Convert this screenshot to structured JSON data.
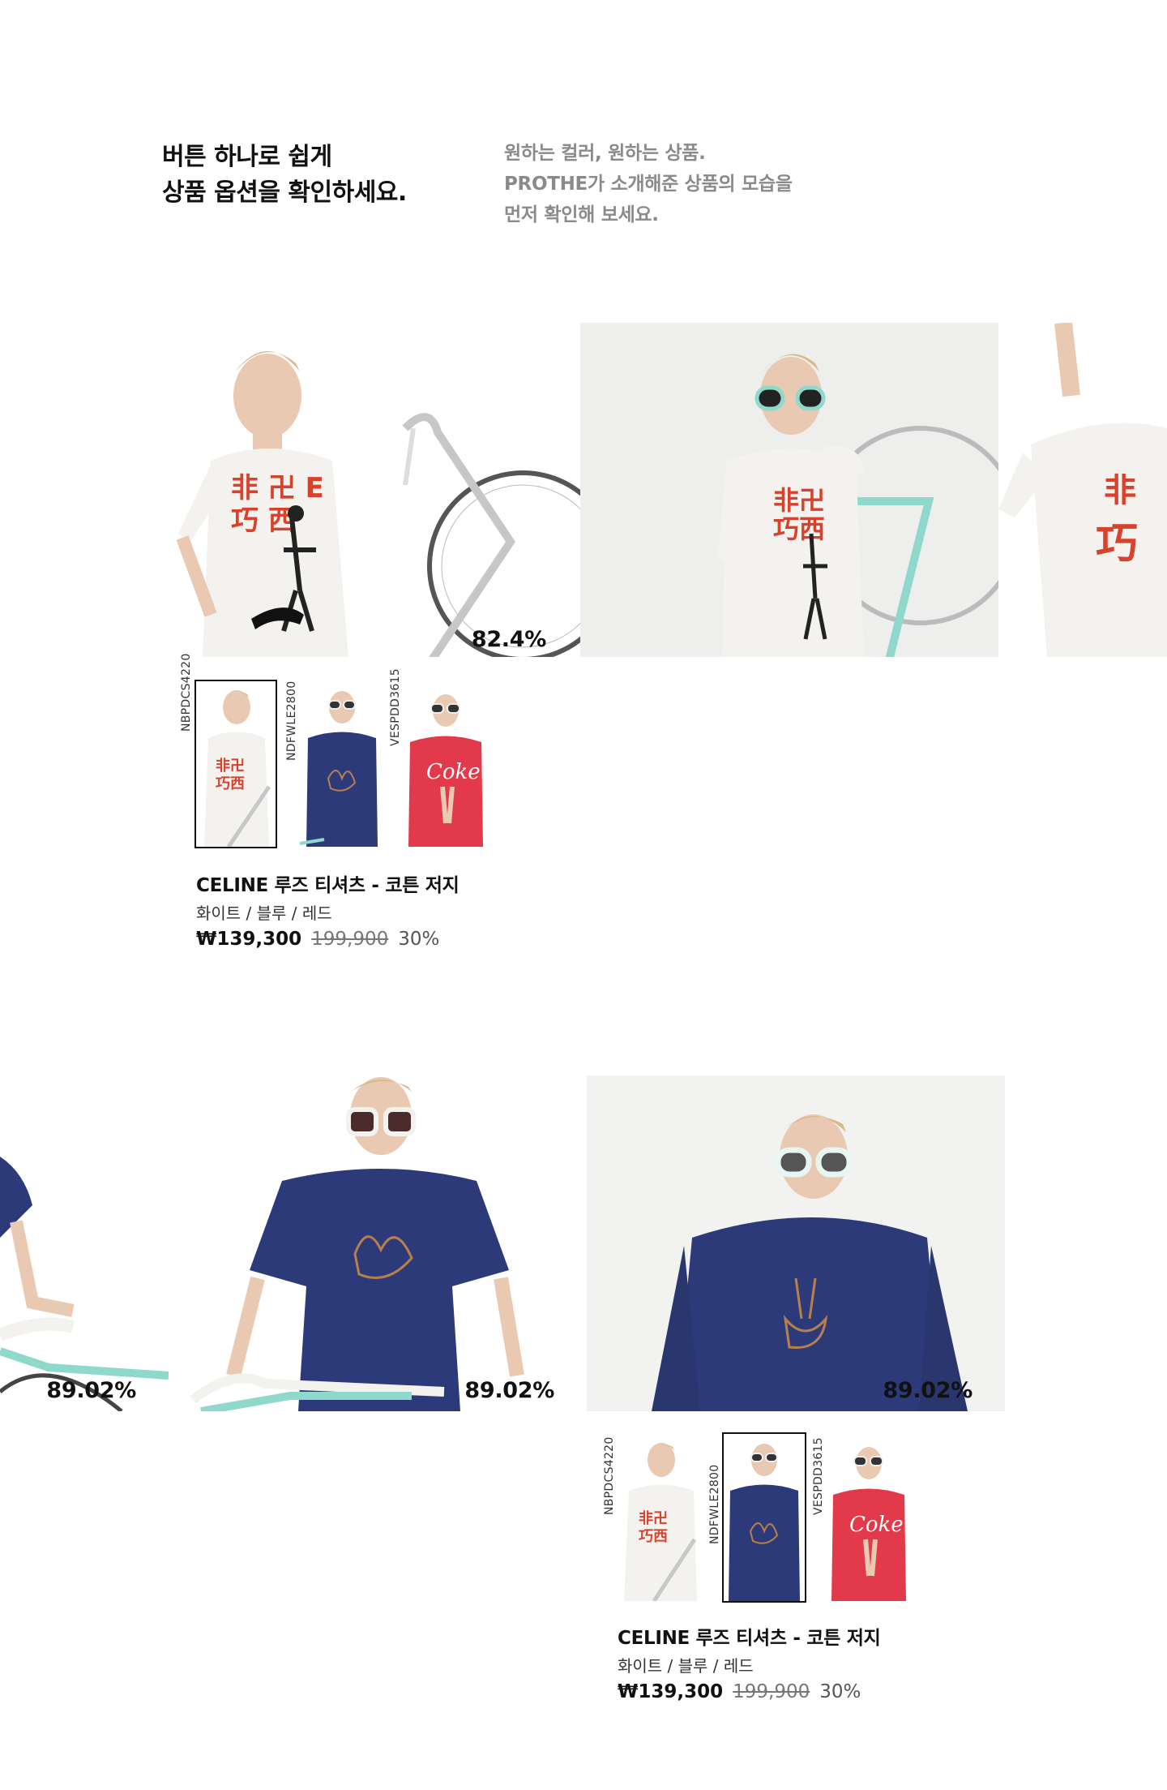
{
  "intro": {
    "headline_lines": [
      "버튼 하나로 쉽게",
      "상품 옵션을 확인하세요."
    ],
    "sub_lines": [
      "원하는 컬러, 원하는 상품.",
      "PROTHE가 소개해준 상품의 모습을",
      "먼저 확인해 보세요."
    ]
  },
  "section1": {
    "tiles": [
      {
        "percent": "82.4%",
        "shirt": "white"
      },
      {
        "percent": "",
        "shirt": "white"
      },
      {
        "percent": "",
        "shirt": "white"
      }
    ],
    "thumbnails": [
      {
        "sku": "NBPDCS4220",
        "shirt": "white",
        "selected": true
      },
      {
        "sku": "NDFWLE2800",
        "shirt": "navy",
        "selected": false
      },
      {
        "sku": "VESPDD3615",
        "shirt": "red",
        "selected": false
      }
    ],
    "product": {
      "name": "CELINE 루즈 티셔츠 - 코튼 저지",
      "colors": "화이트 / 블루 / 레드",
      "price": "₩139,300",
      "original_price": "199,900",
      "discount": "30%"
    }
  },
  "section2": {
    "tiles": [
      {
        "percent": "89.02%",
        "shirt": "navy"
      },
      {
        "percent": "89.02%",
        "shirt": "navy"
      },
      {
        "percent": "89.02%",
        "shirt": "navy"
      }
    ],
    "thumbnails": [
      {
        "sku": "NBPDCS4220",
        "shirt": "white",
        "selected": false
      },
      {
        "sku": "NDFWLE2800",
        "shirt": "navy",
        "selected": true
      },
      {
        "sku": "VESPDD3615",
        "shirt": "red",
        "selected": false
      }
    ],
    "product": {
      "name": "CELINE 루즈 티셔츠 - 코튼 저지",
      "colors": "화이트 / 블루 / 레드",
      "price": "₩139,300",
      "original_price": "199,900",
      "discount": "30%"
    }
  },
  "colors": {
    "white_shirt": "#f4f2ee",
    "navy_shirt": "#2d3a7a",
    "red_shirt": "#e23a4a",
    "bike_teal": "#8fd9cc",
    "bike_silver": "#c7c7c7",
    "skin": "#e9c9b2",
    "hair": "#d8b98a",
    "print_red": "#d8412b",
    "print_gold": "#b7804a"
  }
}
